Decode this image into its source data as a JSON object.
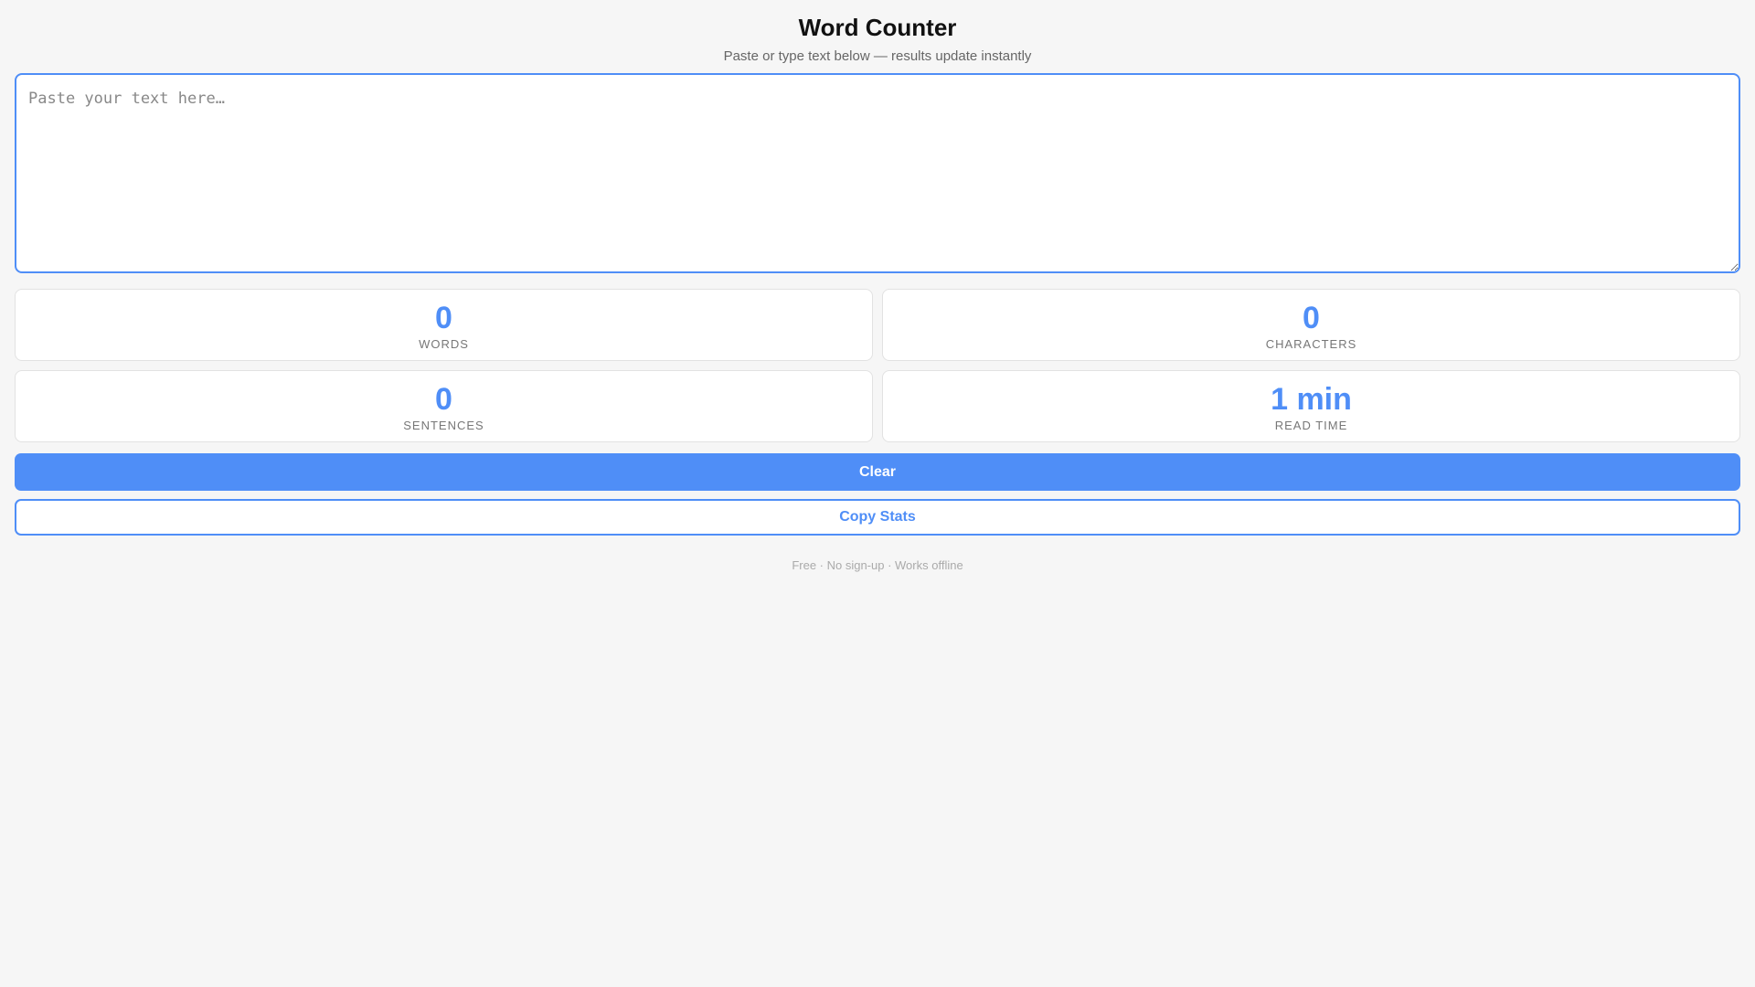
{
  "header": {
    "title": "Word Counter",
    "subtitle": "Paste or type text below — results update instantly"
  },
  "editor": {
    "placeholder": "Paste your text here…",
    "value": ""
  },
  "stats": [
    {
      "value": "0",
      "label": "WORDS"
    },
    {
      "value": "0",
      "label": "CHARACTERS"
    },
    {
      "value": "0",
      "label": "SENTENCES"
    },
    {
      "value": "1 min",
      "label": "READ TIME"
    }
  ],
  "actions": {
    "clear_label": "Clear",
    "copy_label": "Copy Stats"
  },
  "footer": {
    "text": "Free · No sign-up · Works offline"
  },
  "colors": {
    "accent": "#4f8ef7",
    "background": "#f6f6f6"
  }
}
